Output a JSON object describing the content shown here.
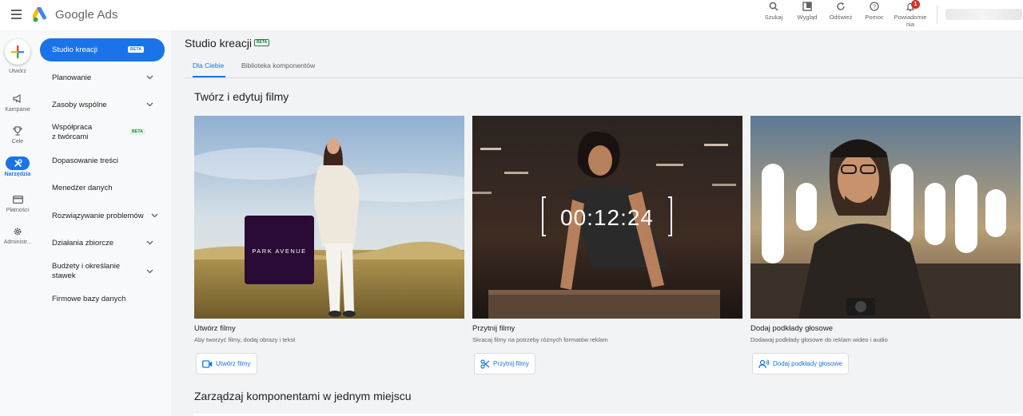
{
  "app": {
    "brand": "Google Ads"
  },
  "toolbar": [
    {
      "label": "Szukaj",
      "icon": "search-icon"
    },
    {
      "label": "Wygląd",
      "icon": "appearance-icon"
    },
    {
      "label": "Odśwież",
      "icon": "refresh-icon"
    },
    {
      "label": "Pomoc",
      "icon": "help-icon"
    },
    {
      "label": "Powiadomie nia",
      "icon": "bell-icon",
      "badge": "1"
    }
  ],
  "rail": [
    {
      "label": "Utwórz",
      "icon": "plus-icon"
    },
    {
      "label": "Kampanie",
      "icon": "megaphone-icon"
    },
    {
      "label": "Cele",
      "icon": "trophy-icon"
    },
    {
      "label": "Narzędzia",
      "icon": "tools-icon",
      "active": true
    },
    {
      "label": "Płatności",
      "icon": "credit-card-icon"
    },
    {
      "label": "Administr...",
      "icon": "gear-icon"
    }
  ],
  "sidenav": [
    {
      "label": "Studio kreacji",
      "badge": "BETA",
      "active": true
    },
    {
      "label": "Planowanie",
      "expandable": true
    },
    {
      "label": "Zasoby wspólne",
      "expandable": true
    },
    {
      "label": "Współpraca z twórcami",
      "line1": "Współpraca",
      "line2": "z twórcami",
      "badge": "BETA"
    },
    {
      "label": "Dopasowanie treści"
    },
    {
      "label": "Menedżer danych"
    },
    {
      "label": "Rozwiązywanie problemów",
      "expandable": true
    },
    {
      "label": "Działania zbiorcze",
      "expandable": true
    },
    {
      "label": "Budżety i określanie stawek",
      "line1": "Budżety i określanie",
      "line2": "stawek",
      "expandable": true
    },
    {
      "label": "Firmowe bazy danych"
    }
  ],
  "main": {
    "title": "Studio kreacji",
    "title_badge": "BETA",
    "tabs": [
      {
        "label": "Dla Ciebie",
        "active": true
      },
      {
        "label": "Biblioteka komponentów"
      }
    ],
    "section1": "Twórz i edytuj filmy",
    "cards": [
      {
        "title": "Utwórz filmy",
        "desc": "Aby tworzyć filmy, dodaj obrazy i tekst",
        "button": "Utwórz filmy",
        "icon": "video-camera-icon",
        "overlay": "PARK AVENUE"
      },
      {
        "title": "Przytnij filmy",
        "desc": "Skracaj filmy na potrzeby różnych formatów reklam",
        "button": "Przytnij filmy",
        "icon": "scissors-icon",
        "overlay": "00:12:24"
      },
      {
        "title": "Dodaj podkłady głosowe",
        "desc": "Dodawaj podkłady głosowe do reklam wideo i audio",
        "button": "Dodaj podkłady głosowe",
        "icon": "voice-icon"
      }
    ],
    "section2": "Zarządzaj komponentami w jednym miejscu"
  },
  "colors": {
    "accent": "#1a73e8",
    "rail_bg": "#f8f9fa",
    "main_bg": "#f1f3f4",
    "badge_red": "#d93025",
    "park_avenue_bg": "#2a0b35"
  }
}
